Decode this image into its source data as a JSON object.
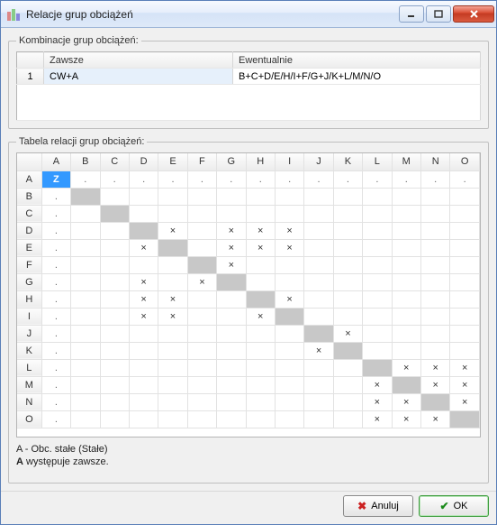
{
  "window": {
    "title": "Relacje grup obciążeń"
  },
  "combos": {
    "legend": "Kombinacje grup obciążeń:",
    "headers": {
      "idx": "",
      "always": "Zawsze",
      "eventual": "Ewentualnie"
    },
    "rows": [
      {
        "idx": "1",
        "always": "CW+A",
        "eventual": "B+C+D/E/H/I+F/G+J/K+L/M/N/O"
      }
    ]
  },
  "relations": {
    "legend": "Tabela relacji grup obciążeń:",
    "labels": [
      "A",
      "B",
      "C",
      "D",
      "E",
      "F",
      "G",
      "H",
      "I",
      "J",
      "K",
      "L",
      "M",
      "N",
      "O"
    ],
    "cells": {
      "A": {
        "A": "Z",
        "B": ".",
        "C": ".",
        "D": ".",
        "E": ".",
        "F": ".",
        "G": ".",
        "H": ".",
        "I": ".",
        "J": ".",
        "K": ".",
        "L": ".",
        "M": ".",
        "N": ".",
        "O": "."
      },
      "B": {
        "A": "."
      },
      "C": {
        "A": "."
      },
      "D": {
        "A": ".",
        "E": "×",
        "G": "×",
        "H": "×",
        "I": "×"
      },
      "E": {
        "A": ".",
        "D": "×",
        "G": "×",
        "H": "×",
        "I": "×"
      },
      "F": {
        "A": ".",
        "G": "×"
      },
      "G": {
        "A": ".",
        "D": "×",
        "F": "×"
      },
      "H": {
        "A": ".",
        "D": "×",
        "E": "×",
        "I": "×"
      },
      "I": {
        "A": ".",
        "D": "×",
        "E": "×",
        "H": "×"
      },
      "J": {
        "A": ".",
        "K": "×"
      },
      "K": {
        "A": ".",
        "J": "×"
      },
      "L": {
        "A": ".",
        "M": "×",
        "N": "×",
        "O": "×"
      },
      "M": {
        "A": ".",
        "L": "×",
        "N": "×",
        "O": "×"
      },
      "N": {
        "A": ".",
        "L": "×",
        "M": "×",
        "O": "×"
      },
      "O": {
        "A": ".",
        "L": "×",
        "M": "×",
        "N": "×"
      }
    },
    "notes": {
      "line1": "A - Obc. stałe (Stałe)",
      "line2_label": "A",
      "line2_text": "  występuje zawsze."
    }
  },
  "buttons": {
    "cancel": "Anuluj",
    "ok": "OK"
  }
}
